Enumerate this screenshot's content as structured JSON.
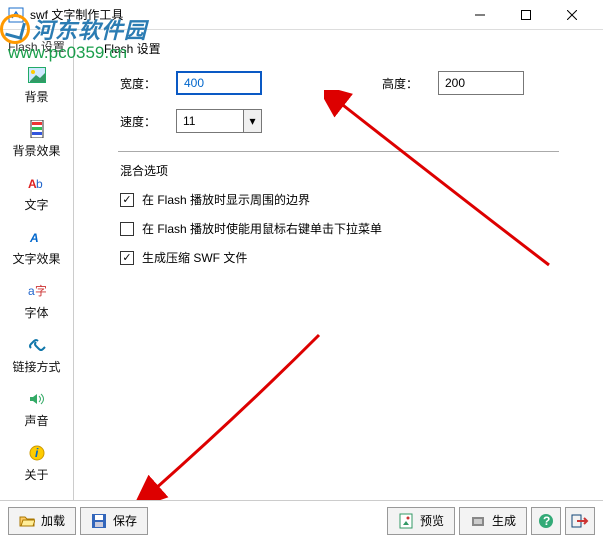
{
  "window": {
    "title": "swf 文字制作工具"
  },
  "watermark": {
    "brand": "河东软件园",
    "url": "www.pc0359.cn"
  },
  "sidebar": {
    "header": "Flash 设置",
    "items": [
      {
        "label": "背景"
      },
      {
        "label": "背景效果"
      },
      {
        "label": "文字"
      },
      {
        "label": "文字效果"
      },
      {
        "label": "字体"
      },
      {
        "label": "链接方式"
      },
      {
        "label": "声音"
      },
      {
        "label": "关于"
      }
    ]
  },
  "panel": {
    "group_title": "Flash 设置",
    "width_label": "宽度：",
    "width_value": "400",
    "height_label": "高度：",
    "height_value": "200",
    "speed_label": "速度：",
    "speed_value": "11",
    "mix_title": "混合选项",
    "chk1": {
      "checked": true,
      "label": "在 Flash 播放时显示周围的边界"
    },
    "chk2": {
      "checked": false,
      "label": "在 Flash 播放时使能用鼠标右键单击下拉菜单"
    },
    "chk3": {
      "checked": true,
      "label": "生成压缩 SWF 文件"
    }
  },
  "bottom": {
    "load": "加载",
    "save": "保存",
    "preview": "预览",
    "build": "生成"
  }
}
